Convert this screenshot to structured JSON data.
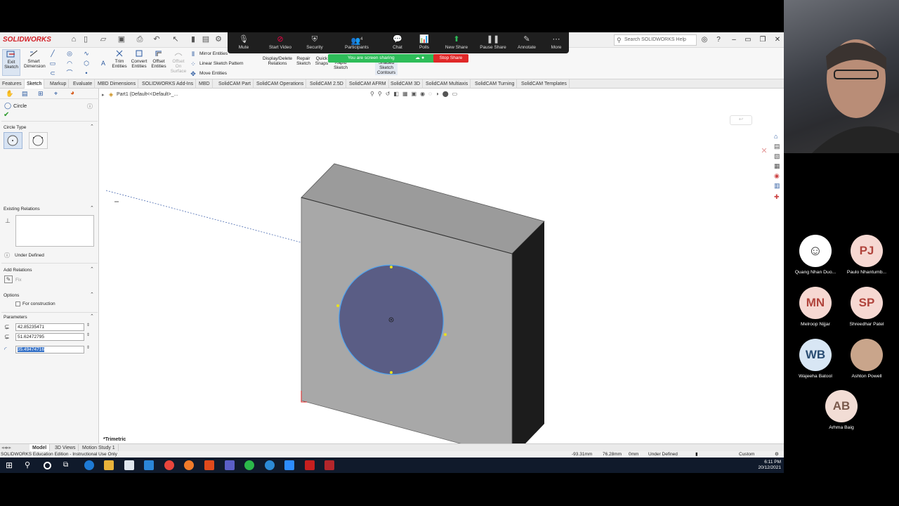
{
  "titlebar": {
    "logo": "SOLIDWORKS",
    "search_placeholder": "Search SOLIDWORKS Help"
  },
  "ribbon": {
    "exit_sketch": "Exit Sketch",
    "smart_dimension": "Smart Dimension",
    "trim_entities": "Trim Entities",
    "convert_entities": "Convert Entities",
    "offset_entities": "Offset Entities",
    "offset_on_surface": "Offset On Surface",
    "mirror_entities": "Mirror Entities",
    "linear_sketch_pattern": "Linear Sketch Pattern",
    "move_entities": "Move Entities",
    "display_delete_relations": "Display/Delete Relations",
    "repair_sketch": "Repair Sketch",
    "quick_snaps": "Quick Snaps",
    "rapid_sketch": "Rapid Sketch",
    "shaded_sketch_contours": "Shaded Sketch Contours"
  },
  "zoom": {
    "mute": "Mute",
    "start_video": "Start Video",
    "security": "Security",
    "participants": "Participants",
    "participants_count": "4",
    "chat": "Chat",
    "polls": "Polls",
    "new_share": "New Share",
    "pause_share": "Pause Share",
    "annotate": "Annotate",
    "more": "More",
    "sharing_banner": "You are screen sharing",
    "stop_share": "Stop Share"
  },
  "tabs": [
    "Features",
    "Sketch",
    "Markup",
    "Evaluate",
    "MBD Dimensions",
    "SOLIDWORKS Add-Ins",
    "MBD",
    "SolidCAM Part",
    "SolidCAM Operations",
    "SolidCAM 2.5D",
    "SolidCAM AFRM",
    "SolidCAM 3D",
    "SolidCAM Multiaxis",
    "SolidCAM Turning",
    "SolidCAM Templates"
  ],
  "property_manager": {
    "title": "Circle",
    "circle_type": "Circle Type",
    "existing_relations": "Existing Relations",
    "status": "Under Defined",
    "add_relations": "Add Relations",
    "fix": "Fix",
    "options": "Options",
    "for_construction": "For construction",
    "parameters": "Parameters",
    "param_x": "42.85235471",
    "param_y": "51.62472795",
    "param_r": "35.49474716"
  },
  "graphics": {
    "doc_title": "Part1 (Default<<Default>_...",
    "view_label": "*Trimetric"
  },
  "bottom_tabs": [
    "Model",
    "3D Views",
    "Motion Study 1"
  ],
  "statusbar": {
    "left": "SOLIDWORKS Education Edition - Instructional Use Only",
    "x": "-93.31mm",
    "y": "76.28mm",
    "z": "0mm",
    "state": "Under Defined",
    "units": "Custom"
  },
  "taskbar": {
    "time": "6:11 PM",
    "date": "20/12/2021"
  },
  "participants": [
    {
      "initials": "",
      "name": "Quang Nhan Duo..."
    },
    {
      "initials": "PJ",
      "name": "Paulo Nhantumb..."
    },
    {
      "initials": "MN",
      "name": "Melroop Nijjar"
    },
    {
      "initials": "SP",
      "name": "Shreedhar Patel"
    },
    {
      "initials": "WB",
      "name": "Wajeeha Batool"
    },
    {
      "initials": "",
      "name": "Ashton Powell"
    },
    {
      "initials": "AB",
      "name": "Arhma Baig"
    }
  ],
  "colors": {
    "sw_red": "#d32027",
    "zoom_green": "#2ebd59",
    "stop_red": "#e02828",
    "circle_fill": "#5a5d85",
    "circle_edge": "#4da3f0",
    "block_front": "#a8a8a8",
    "block_top": "#9a9a9a",
    "block_side": "#1c1c1c"
  }
}
